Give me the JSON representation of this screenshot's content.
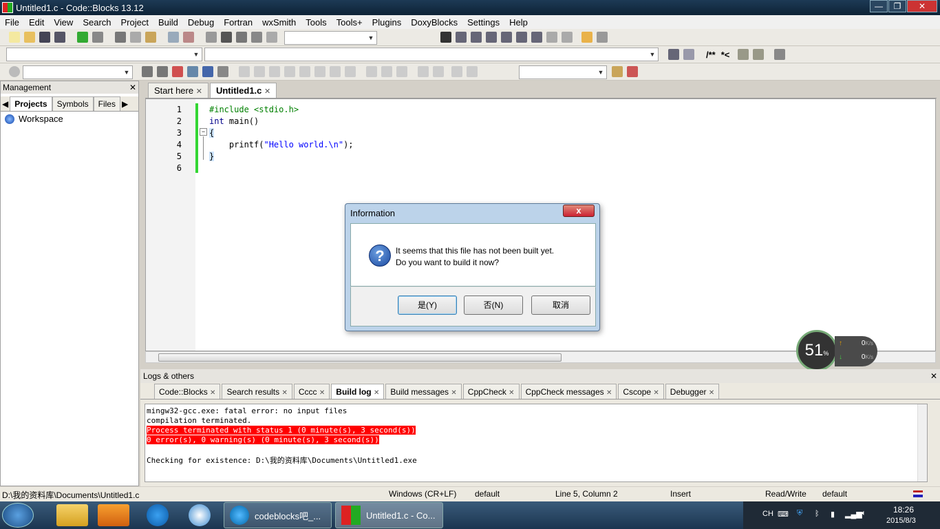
{
  "window": {
    "title": "Untitled1.c - Code::Blocks 13.12"
  },
  "menu": [
    "File",
    "Edit",
    "View",
    "Search",
    "Project",
    "Build",
    "Debug",
    "Fortran",
    "wxSmith",
    "Tools",
    "Tools+",
    "Plugins",
    "DoxyBlocks",
    "Settings",
    "Help"
  ],
  "toolbar": {
    "doxy_block": "/**",
    "doxy_line": "*<"
  },
  "management": {
    "title": "Management",
    "tabs": [
      "Projects",
      "Symbols",
      "Files"
    ],
    "workspace": "Workspace"
  },
  "editor_tabs": [
    "Start here",
    "Untitled1.c"
  ],
  "editor": {
    "line_numbers": [
      "1",
      "2",
      "3",
      "4",
      "5",
      "6"
    ],
    "code": {
      "l1": "#include <stdio.h>",
      "l2_kw": "int",
      "l2_rest": " main()",
      "l3": "{",
      "l4_a": "    printf(",
      "l4_str": "\"Hello world.\\n\"",
      "l4_b": ");",
      "l5": "}"
    }
  },
  "dialog": {
    "title": "Information",
    "close": "x",
    "line1": "It seems that this file has not been built yet.",
    "line2": "Do you want to build it now?",
    "yes": "是(Y)",
    "no": "否(N)",
    "cancel": "取消"
  },
  "logs": {
    "title": "Logs & others",
    "tabs": [
      "Code::Blocks",
      "Search results",
      "Cccc",
      "Build log",
      "Build messages",
      "CppCheck",
      "CppCheck messages",
      "Cscope",
      "Debugger"
    ],
    "lines": [
      "mingw32-gcc.exe: fatal error: no input files",
      "compilation terminated.",
      "Process terminated with status 1 (0 minute(s), 3 second(s))",
      "0 error(s), 0 warning(s) (0 minute(s), 3 second(s))",
      "Checking for existence: D:\\我的资料库\\Documents\\Untitled1.exe"
    ]
  },
  "statusbar": {
    "path": "D:\\我的资料库\\Documents\\Untitled1.c",
    "eol": "Windows (CR+LF)",
    "encoding": "default",
    "position": "Line 5, Column 2",
    "mode": "Insert",
    "access": "Read/Write",
    "lang": "default"
  },
  "netwidget": {
    "percent": "51",
    "unit": "%",
    "up": "0",
    "down": "0",
    "rate_unit": "K/s"
  },
  "taskbar": {
    "win1": "codeblocks吧_...",
    "win2": "Untitled1.c - Co...",
    "tray_lang": "CH",
    "time": "18:26",
    "date": "2015/8/3"
  },
  "colors": {
    "error_bg": "#ff0000",
    "change_bar": "#33d633",
    "titlebar": "#1d3a55"
  }
}
